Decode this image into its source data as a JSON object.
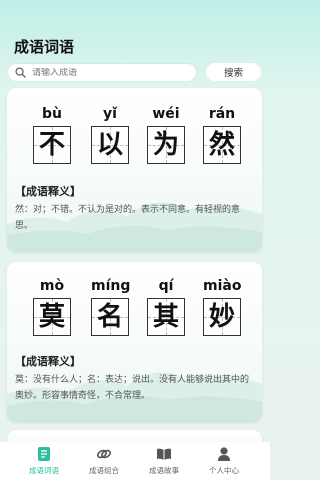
{
  "header": {
    "title": "成语词语"
  },
  "search": {
    "placeholder": "请输入成语",
    "button_label": "搜索"
  },
  "cards": [
    {
      "chars": [
        {
          "pinyin": "bù",
          "hanzi": "不"
        },
        {
          "pinyin": "yǐ",
          "hanzi": "以"
        },
        {
          "pinyin": "wéi",
          "hanzi": "为"
        },
        {
          "pinyin": "rán",
          "hanzi": "然"
        }
      ],
      "def_title": "【成语释义】",
      "def_text": "然：对；不错。不认为是对的。表示不同意。有轻视的意思。"
    },
    {
      "chars": [
        {
          "pinyin": "mò",
          "hanzi": "莫"
        },
        {
          "pinyin": "míng",
          "hanzi": "名"
        },
        {
          "pinyin": "qí",
          "hanzi": "其"
        },
        {
          "pinyin": "miào",
          "hanzi": "妙"
        }
      ],
      "def_title": "【成语释义】",
      "def_text": "莫：没有什么人；名：表达；说出。没有人能够说出其中的奥妙。形容事情奇怪，不合常理。"
    }
  ],
  "tabbar": [
    {
      "label": "成语词语",
      "icon": "book-icon",
      "active": true
    },
    {
      "label": "成语组合",
      "icon": "link-icon",
      "active": false
    },
    {
      "label": "成语故事",
      "icon": "open-book-icon",
      "active": false
    },
    {
      "label": "个人中心",
      "icon": "person-icon",
      "active": false
    }
  ],
  "colors": {
    "accent": "#2dbfa0",
    "background": "#dff5ef"
  }
}
